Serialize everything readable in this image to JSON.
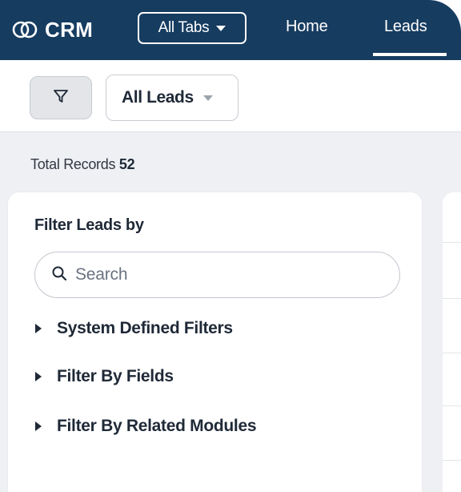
{
  "topbar": {
    "logo_text": "CRM",
    "all_tabs_label": "All Tabs",
    "nav": [
      {
        "label": "Home"
      },
      {
        "label": "Leads",
        "active": true
      }
    ]
  },
  "toolbar": {
    "view_select_value": "All Leads"
  },
  "summary": {
    "total_label": "Total Records",
    "total_count": "52"
  },
  "filter_panel": {
    "title": "Filter Leads by",
    "search_placeholder": "Search",
    "groups": [
      {
        "label": "System Defined Filters"
      },
      {
        "label": "Filter By Fields"
      },
      {
        "label": "Filter By Related Modules"
      }
    ]
  },
  "icons": {
    "logo": "crm-logo-icon",
    "filter": "filter-funnel-icon",
    "search": "search-icon",
    "expand": "caret-right-icon",
    "dropdown": "caret-down-icon"
  },
  "colors": {
    "topbar_bg": "#163c60",
    "page_bg": "#eef0f4",
    "text_primary": "#1f2937"
  }
}
